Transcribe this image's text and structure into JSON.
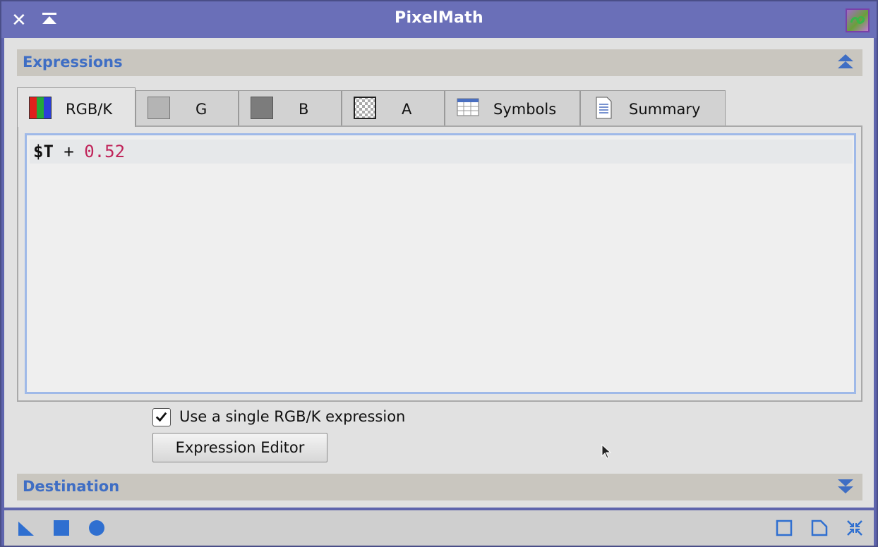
{
  "window": {
    "title": "PixelMath",
    "close_icon": "close-icon",
    "shade_icon": "shade-icon",
    "app_icon": "pixelmath-app-icon"
  },
  "expressions": {
    "section_title": "Expressions",
    "collapse_icon": "collapse-up-icon",
    "tabs": [
      {
        "label": "RGB/K",
        "icon": "rgb-swatch-icon",
        "active": true
      },
      {
        "label": "G",
        "icon": "gray-swatch-icon",
        "active": false
      },
      {
        "label": "B",
        "icon": "dark-gray-swatch-icon",
        "active": false
      },
      {
        "label": "A",
        "icon": "checker-swatch-icon",
        "active": false
      },
      {
        "label": "Symbols",
        "icon": "table-icon",
        "active": false
      },
      {
        "label": "Summary",
        "icon": "document-icon",
        "active": false
      }
    ],
    "code": {
      "variable": "$T",
      "operator": "+",
      "number": "0.52"
    },
    "single_expression_label": "Use a single RGB/K expression",
    "single_expression_checked": true,
    "expression_editor_label": "Expression Editor"
  },
  "destination": {
    "section_title": "Destination",
    "expand_icon": "expand-down-icon"
  },
  "footer": {
    "left_icons": [
      "new-instance-icon",
      "apply-global-icon",
      "apply-icon"
    ],
    "right_icons": [
      "preview-icon",
      "document-browser-icon",
      "reset-icon"
    ]
  },
  "colors": {
    "titlebar": "#6a6fb8",
    "section_title": "#3f6ec4",
    "number_literal": "#c0245a",
    "editor_border": "#9fb9e8"
  }
}
